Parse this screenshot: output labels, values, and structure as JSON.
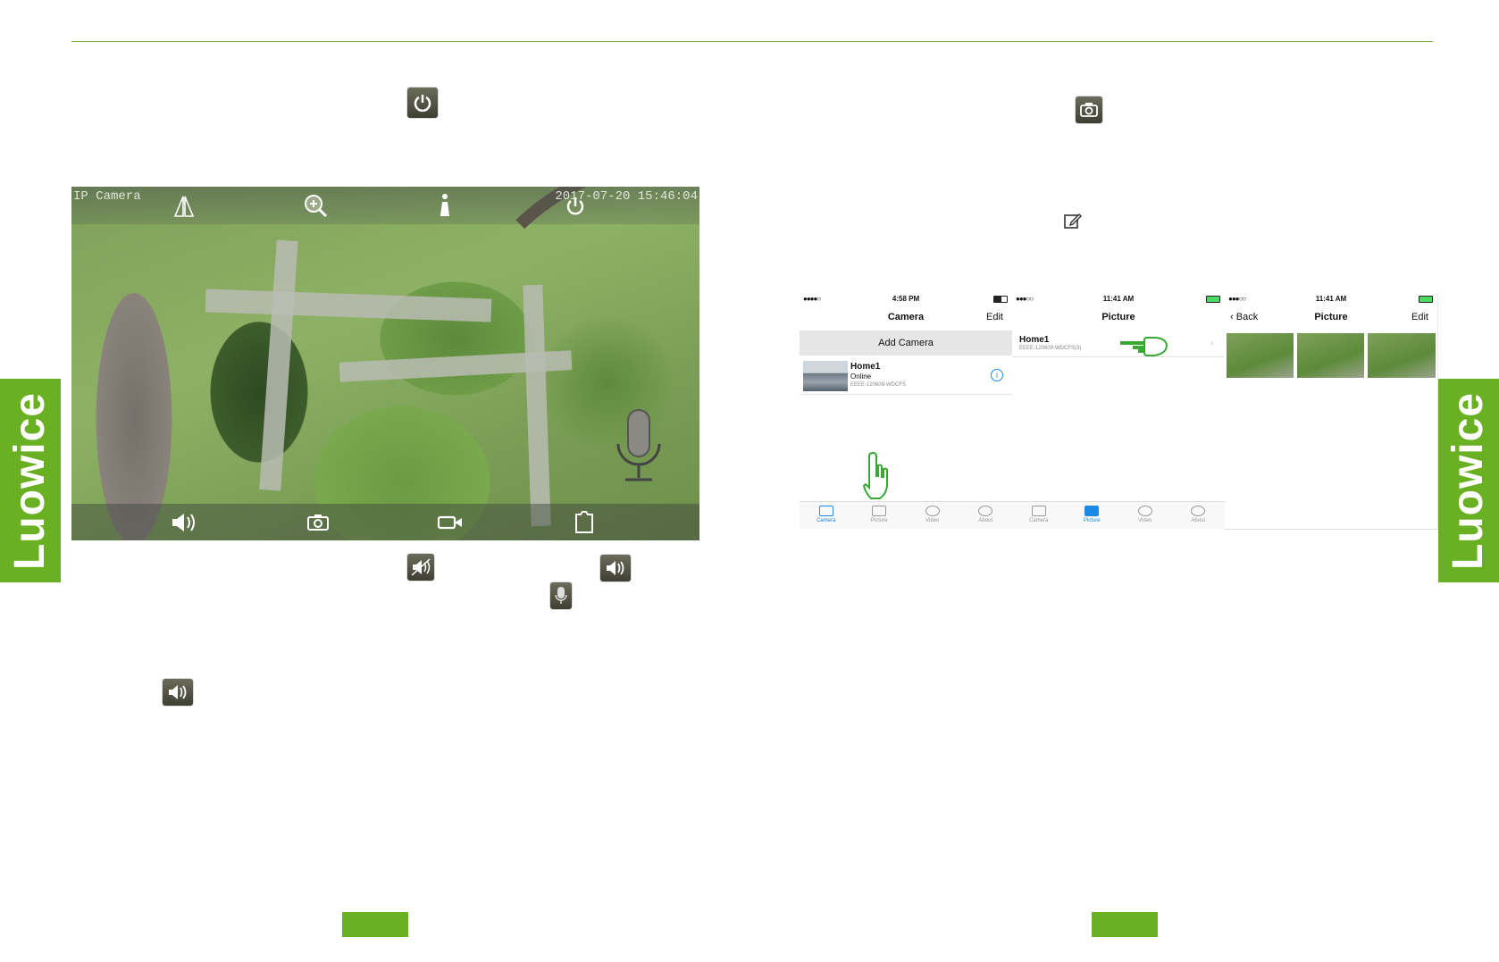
{
  "brand": {
    "side_label": "Luowice",
    "accent_color": "#6ab023"
  },
  "camera_view": {
    "overlay_title": "IP Camera",
    "timestamp": "2017-07-20 15:46:04",
    "top_icons": [
      "mirror-icon",
      "zoom-in-icon",
      "pan-tilt-icon",
      "power-icon"
    ],
    "bottom_icons": [
      "speaker-icon",
      "snapshot-icon",
      "record-video-icon",
      "fullscreen-icon"
    ],
    "mic_icon": "microphone-icon"
  },
  "inline_icons": [
    "power-icon",
    "snapshot-icon",
    "edit-icon",
    "mute-icon",
    "speaker-icon",
    "microphone-icon",
    "speaker-icon"
  ],
  "phones": [
    {
      "status_time": "4:58 PM",
      "nav_title": "Camera",
      "nav_right": "Edit",
      "add_button": "Add Camera",
      "camera_name": "Home1",
      "camera_status": "Online",
      "camera_id": "EEEE-120609-WDCFS",
      "tabs": [
        "Camera",
        "Picture",
        "Video",
        "About"
      ],
      "active_tab": "Camera"
    },
    {
      "status_time": "11:41 AM",
      "nav_title": "Picture",
      "row_title": "Home1",
      "row_subtitle": "EEEE-120609-WDCFS(3)",
      "tabs": [
        "Camera",
        "Picture",
        "Video",
        "About"
      ],
      "active_tab": "Picture"
    },
    {
      "status_time": "11:41 AM",
      "nav_left": "Back",
      "nav_title": "Picture",
      "nav_right": "Edit",
      "thumbnail_count": 3
    }
  ]
}
